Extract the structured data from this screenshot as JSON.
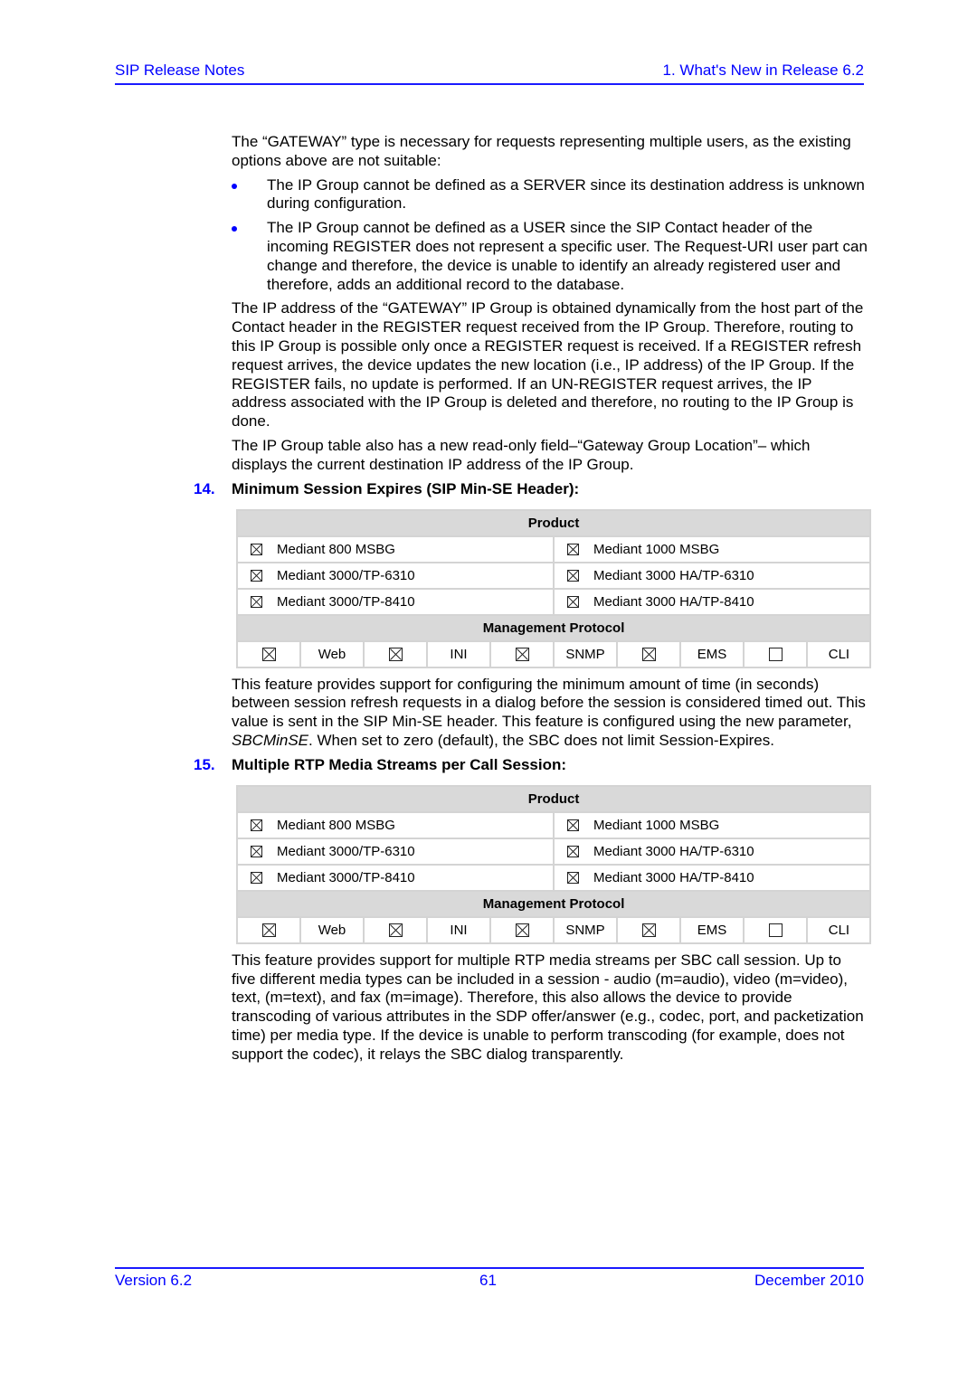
{
  "header": {
    "left": "SIP Release Notes",
    "right": "1. What's New in Release 6.2"
  },
  "intro": {
    "paragraph1": "The “GATEWAY” type is necessary for requests representing multiple users, as the existing options above are not suitable:",
    "bullets": [
      "The IP Group cannot be defined as a SERVER since its destination address is unknown during configuration.",
      "The IP Group cannot be defined as a USER since the SIP Contact header of the incoming REGISTER does not represent a specific user. The Request-URI user part can change and therefore, the device is unable to identify an already registered user and therefore, adds an additional record to the database."
    ],
    "paragraph2": "The IP address of the “GATEWAY” IP Group is obtained dynamically from the host part of the Contact header in the REGISTER request received from the IP Group. Therefore, routing to this IP Group is possible only once a REGISTER request is received. If a REGISTER refresh request arrives, the device updates the new location (i.e., IP address) of the IP Group. If the REGISTER fails, no update is performed. If an UN-REGISTER request arrives, the IP address associated with the IP Group is deleted and therefore, no routing to the IP Group is done.",
    "paragraph3": "The IP Group table also has a new read-only field–“Gateway Group Location”– which displays the current destination IP address of the IP Group."
  },
  "sections": [
    {
      "number": "14.",
      "title": "Minimum Session Expires (SIP Min-SE Header):",
      "table": {
        "product_header": "Product",
        "products": [
          {
            "label": "Mediant 800 MSBG",
            "checked": true
          },
          {
            "label": "Mediant 1000 MSBG",
            "checked": true
          },
          {
            "label": "Mediant 3000/TP-6310",
            "checked": true
          },
          {
            "label": "Mediant 3000 HA/TP-6310",
            "checked": true
          },
          {
            "label": "Mediant 3000/TP-8410",
            "checked": true
          },
          {
            "label": "Mediant 3000 HA/TP-8410",
            "checked": true
          }
        ],
        "protocol_header": "Management Protocol",
        "protocols": [
          {
            "label": "Web",
            "checked": true
          },
          {
            "label": "INI",
            "checked": true
          },
          {
            "label": "SNMP",
            "checked": true
          },
          {
            "label": "EMS",
            "checked": true
          },
          {
            "label": "CLI",
            "checked": false
          }
        ]
      },
      "body_before_italic": "This feature provides support for configuring the minimum amount of time (in seconds) between session refresh requests in a dialog before the session is considered timed out. This value is sent in the SIP Min-SE header. This feature is configured using the new parameter, ",
      "body_italic": "SBCMinSE",
      "body_after_italic": ". When set to zero (default), the SBC does not limit Session-Expires."
    },
    {
      "number": "15.",
      "title": "Multiple RTP Media Streams per Call Session:",
      "table": {
        "product_header": "Product",
        "products": [
          {
            "label": "Mediant 800 MSBG",
            "checked": true
          },
          {
            "label": "Mediant 1000 MSBG",
            "checked": true
          },
          {
            "label": "Mediant 3000/TP-6310",
            "checked": true
          },
          {
            "label": "Mediant 3000 HA/TP-6310",
            "checked": true
          },
          {
            "label": "Mediant 3000/TP-8410",
            "checked": true
          },
          {
            "label": "Mediant 3000 HA/TP-8410",
            "checked": true
          }
        ],
        "protocol_header": "Management Protocol",
        "protocols": [
          {
            "label": "Web",
            "checked": true
          },
          {
            "label": "INI",
            "checked": true
          },
          {
            "label": "SNMP",
            "checked": true
          },
          {
            "label": "EMS",
            "checked": true
          },
          {
            "label": "CLI",
            "checked": false
          }
        ]
      },
      "body": "This feature provides support for multiple RTP media streams per SBC call session. Up to five different media types can be included in a session - audio (m=audio), video (m=video), text, (m=text), and fax (m=image). Therefore, this also allows the device to provide transcoding of various attributes in the SDP offer/answer (e.g., codec, port, and packetization time) per media type. If the device is unable to perform transcoding (for example, does not support the codec), it relays the SBC dialog transparently."
    }
  ],
  "footer": {
    "version": "Version 6.2",
    "page_number": "61",
    "date": "December 2010"
  },
  "colors": {
    "accent_blue": "#0000ff",
    "table_header_bg": "#d9d9d9",
    "table_border": "#d4d4d4"
  }
}
